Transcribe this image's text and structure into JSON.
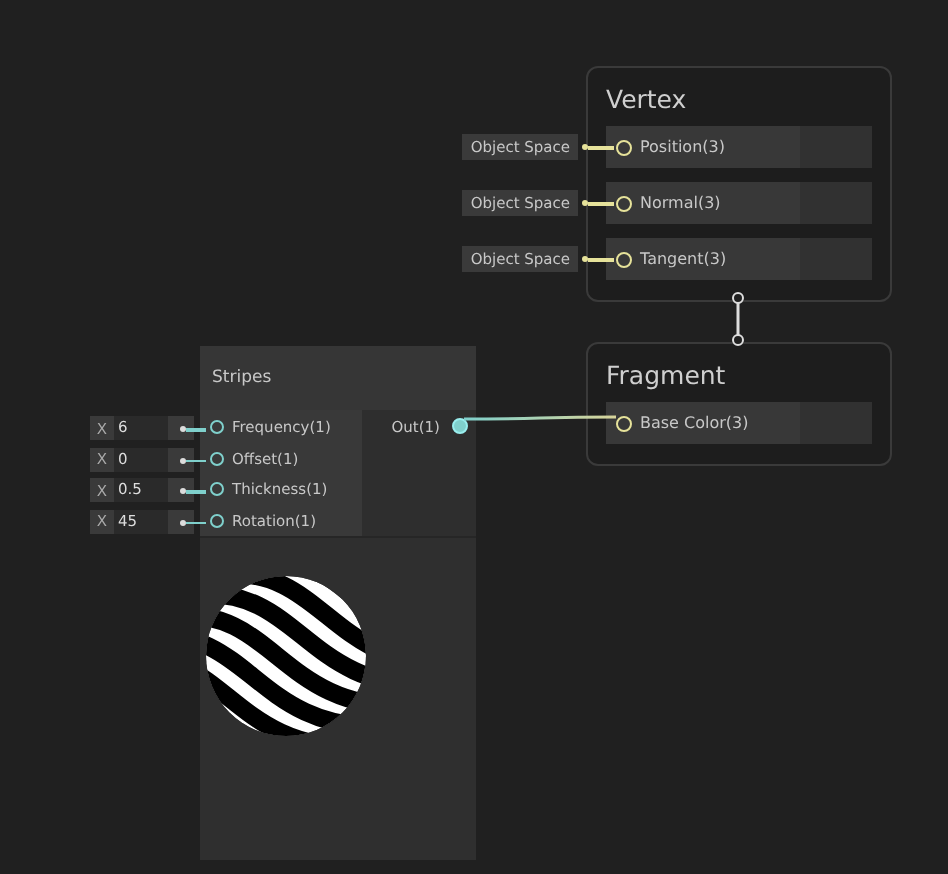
{
  "nodes": [
    {
      "kind": "master",
      "title": "Vertex",
      "ports": [
        {
          "label": "Position(3)",
          "input": "Object Space"
        },
        {
          "label": "Normal(3)",
          "input": "Object Space"
        },
        {
          "label": "Tangent(3)",
          "input": "Object Space"
        }
      ]
    },
    {
      "kind": "function",
      "title": "Stripes",
      "inputs": [
        {
          "axis": "X",
          "value": "6",
          "label": "Frequency(1)"
        },
        {
          "axis": "X",
          "value": "0",
          "label": "Offset(1)"
        },
        {
          "axis": "X",
          "value": "0.5",
          "label": "Thickness(1)"
        },
        {
          "axis": "X",
          "value": "45",
          "label": "Rotation(1)"
        }
      ],
      "outputs": [
        "Out(1)"
      ]
    },
    {
      "kind": "master",
      "title": "Fragment",
      "ports": [
        {
          "label": "Base Color(3)"
        }
      ]
    }
  ]
}
